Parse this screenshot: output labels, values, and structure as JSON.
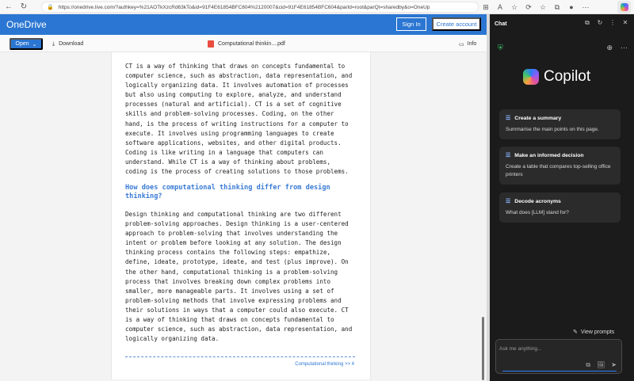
{
  "browser": {
    "url": "https://onedrive.live.com/?authkey=%21AOTkXzcRd63kTo&id=91F4E61854BFC604%2120007&cid=91F4E61854BFC604&parId=root&parQt=sharedby&o=OneUp",
    "back_glyph": "←",
    "refresh_glyph": "↻",
    "lock_glyph": "🔒",
    "toolbar_glyphs": [
      "⊞",
      "A",
      "☆",
      "⟳",
      "☆",
      "⧉",
      "●",
      "⋯"
    ]
  },
  "onedrive": {
    "brand": "OneDrive",
    "sign_in": "Sign In",
    "create_account": "Create account"
  },
  "command_bar": {
    "open": "Open",
    "open_caret": "⌄",
    "download": "Download",
    "download_glyph": "⤓",
    "file_name": "Computational thinkin....pdf",
    "info": "Info",
    "info_glyph": "▭"
  },
  "document": {
    "para1": "CT is a way of thinking that draws on concepts fundamental to\ncomputer science, such as abstraction, data representation, and\nlogically organizing data. It involves automation of processes\nbut also using computing to explore, analyze, and understand\nprocesses (natural and artificial). CT is a set of cognitive\nskills and problem-solving processes. Coding, on the other\nhand, is the process of writing instructions for a computer to\nexecute. It involves using programming languages to create\nsoftware applications, websites, and other digital products.\nCoding is like writing in a language that computers can\nunderstand. While CT is a way of thinking about problems,\ncoding is the process of creating solutions to those problems.",
    "heading": "How does computational thinking differ from design\nthinking?",
    "para2": "Design thinking and computational thinking are two different\nproblem-solving approaches. Design thinking is a user-centered\napproach to problem-solving that involves understanding the\nintent or problem before looking at any solution. The design\nthinking process contains the following steps: empathize,\ndefine, ideate, prototype, ideate, and test (plus improve). On\nthe other hand, computational thinking is a problem-solving\nprocess that involves breaking down complex problems into\nsmaller, more manageable parts. It involves using a set of\nproblem-solving methods that involve expressing problems and\ntheir solutions in ways that a computer could also execute. CT\nis a way of thinking that draws on concepts fundamental to\ncomputer science, such as abstraction, data representation, and\nlogically organizing data.",
    "footer": "Computational thinking  >>  4"
  },
  "copilot": {
    "panel_title": "Chat",
    "top_icons": [
      "⧉",
      "↻",
      "⋮",
      "✕"
    ],
    "shield_glyph": "⛨",
    "action_icons": [
      "⊕",
      "⋯"
    ],
    "logo_text": "Copilot",
    "cards": [
      {
        "title": "Create a summary",
        "body": "Summarise the main points on this page.",
        "icon": "☰"
      },
      {
        "title": "Make an informed decision",
        "body": "Create a table that compares top-selling office printers",
        "icon": "☰"
      },
      {
        "title": "Decode acronyms",
        "body": "What does [LLM] stand for?",
        "icon": "☰"
      }
    ],
    "view_prompts": "View prompts",
    "view_prompts_glyph": "✎",
    "ask_placeholder": "Ask me anything...",
    "composer_icons": [
      "⧉",
      "🖼",
      "➤"
    ]
  },
  "colors": {
    "onedrive_blue": "#2b76d2",
    "panel_bg": "#1b1b1b",
    "heading_blue": "#3a7bd5"
  }
}
